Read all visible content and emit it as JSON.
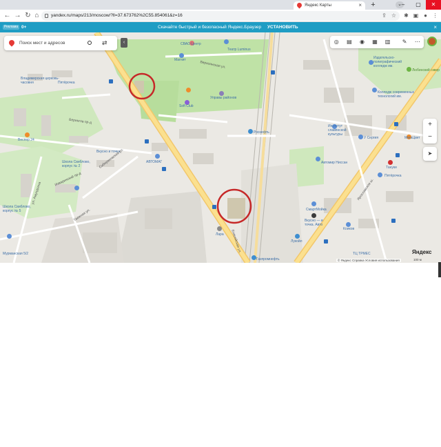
{
  "browser": {
    "tab_title": "Яндекс Карты",
    "url": "yandex.ru/maps/213/moscow/?ll=37.673762%2C55.854061&z=16",
    "new_tab_icon": "plus-icon",
    "tab_close_icon": "close-icon"
  },
  "promo": {
    "ad_badge": "Реклама",
    "age": "0+",
    "message": "Скачайте быстрый и безопасный Яндекс.Браузер",
    "cta": "УСТАНОВИТЬ"
  },
  "map": {
    "search_placeholder": "Поиск мест и адресов",
    "labels": [
      {
        "text": "СВАО Центр",
        "kind": "poi"
      },
      {
        "text": "Магнит",
        "kind": "poi"
      },
      {
        "text": "Театр Luminus",
        "kind": "poi"
      },
      {
        "text": "Верхоянская ул.",
        "kind": "street"
      },
      {
        "text": "Владимирская церковь-часовня",
        "kind": "poi"
      },
      {
        "text": "Пятёрочка",
        "kind": "poi"
      },
      {
        "text": "Управы районов",
        "kind": "poi"
      },
      {
        "text": "Soft Club",
        "kind": "poi"
      },
      {
        "text": "Берингов пр-д",
        "kind": "street"
      },
      {
        "text": "Вкусно и точка",
        "kind": "poi"
      },
      {
        "text": "Веспер 24",
        "kind": "poi"
      },
      {
        "text": "Школа Свиблово, корпус № 2",
        "kind": "poi"
      },
      {
        "text": "Сибиряковская ул.",
        "kind": "street"
      },
      {
        "text": "АВТОМАГ",
        "kind": "poi"
      },
      {
        "text": "Изваринский пр-д",
        "kind": "street"
      },
      {
        "text": "ул. Амундсена",
        "kind": "street"
      },
      {
        "text": "Школа Свиблово, корпус № 5",
        "kind": "poi"
      },
      {
        "text": "Таежная ул.",
        "kind": "street"
      },
      {
        "text": "Енисейская ул.",
        "kind": "street"
      },
      {
        "text": "Лара",
        "kind": "poi"
      },
      {
        "text": "Газпромнефть",
        "kind": "poi"
      },
      {
        "text": "Издательско-полиграфический колледж им.",
        "kind": "poi"
      },
      {
        "text": "Любинский сквер",
        "kind": "green"
      },
      {
        "text": "Колледж современных технологий им.",
        "kind": "poi"
      },
      {
        "text": "Роснефть",
        "kind": "poi"
      },
      {
        "text": "Институт славянской культуры",
        "kind": "poi"
      },
      {
        "text": "У Сергия",
        "kind": "poi"
      },
      {
        "text": "МегаЦвет",
        "kind": "poi"
      },
      {
        "text": "Автомир Ниссан",
        "kind": "poi"
      },
      {
        "text": "Ярославское ш.",
        "kind": "street"
      },
      {
        "text": "Тануки",
        "kind": "poi"
      },
      {
        "text": "Пятёрочка",
        "kind": "poi"
      },
      {
        "text": "СмартМойка",
        "kind": "poi"
      },
      {
        "text": "Вкусно — и точка. Авто",
        "kind": "poi"
      },
      {
        "text": "Лукойл",
        "kind": "poi"
      },
      {
        "text": "Коиков",
        "kind": "poi"
      },
      {
        "text": "ТЦ ТРМЕС",
        "kind": "poi"
      },
      {
        "text": "Мурманская 5/2",
        "kind": "poi"
      }
    ],
    "attribution": "© Яндекс  Справка  Условия использования",
    "scale": "100 м",
    "logo": "Яндекс"
  }
}
